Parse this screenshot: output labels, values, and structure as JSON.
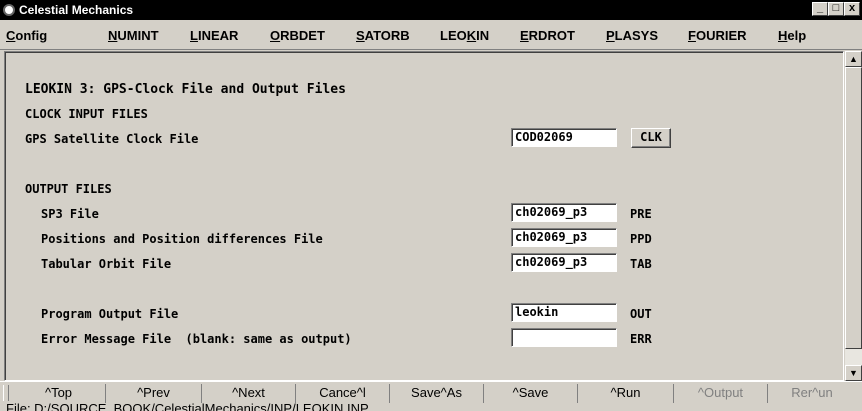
{
  "window": {
    "title": "Celestial Mechanics",
    "controls": [
      "_",
      "□",
      "x"
    ]
  },
  "menu": [
    {
      "label": "Config",
      "u": "C"
    },
    {
      "label": "NUMINT",
      "u": "N"
    },
    {
      "label": "LINEAR",
      "u": "L"
    },
    {
      "label": "ORBDET",
      "u": "O"
    },
    {
      "label": "SATORB",
      "u": "S"
    },
    {
      "label": "LEOKIN",
      "u": "K"
    },
    {
      "label": "ERDROT",
      "u": "E"
    },
    {
      "label": "PLASYS",
      "u": "P"
    },
    {
      "label": "FOURIER",
      "u": "F"
    },
    {
      "label": "Help",
      "u": "H"
    }
  ],
  "panel": {
    "heading": "LEOKIN 3: GPS-Clock File and Output Files",
    "clock_section": "CLOCK INPUT FILES",
    "clock_label": "GPS Satellite Clock File",
    "clock_value": "COD02069",
    "clock_button": "CLK",
    "output_section": "OUTPUT FILES",
    "rows": [
      {
        "label": "SP3 File",
        "value": "ch02069_p3",
        "tag": "PRE"
      },
      {
        "label": "Positions and Position differences File",
        "value": "ch02069_p3",
        "tag": "PPD"
      },
      {
        "label": "Tabular Orbit File",
        "value": "ch02069_p3",
        "tag": "TAB"
      },
      {
        "label": "Program Output File",
        "value": "leokin",
        "tag": "OUT"
      },
      {
        "label": "Error Message File  (blank: same as output)",
        "value": "",
        "tag": "ERR"
      }
    ]
  },
  "buttons": [
    {
      "label": "^Top",
      "enabled": true
    },
    {
      "label": "^Prev",
      "enabled": true
    },
    {
      "label": "^Next",
      "enabled": true
    },
    {
      "label": "Cance^l",
      "enabled": true
    },
    {
      "label": "Save^As",
      "enabled": true
    },
    {
      "label": "^Save",
      "enabled": true
    },
    {
      "label": "^Run",
      "enabled": true
    },
    {
      "label": "^Output",
      "enabled": false
    },
    {
      "label": "Rer^un",
      "enabled": false
    }
  ],
  "status": "File: D:/SOURCE_BOOK/CelestialMechanics/INP/LEOKIN.INP"
}
